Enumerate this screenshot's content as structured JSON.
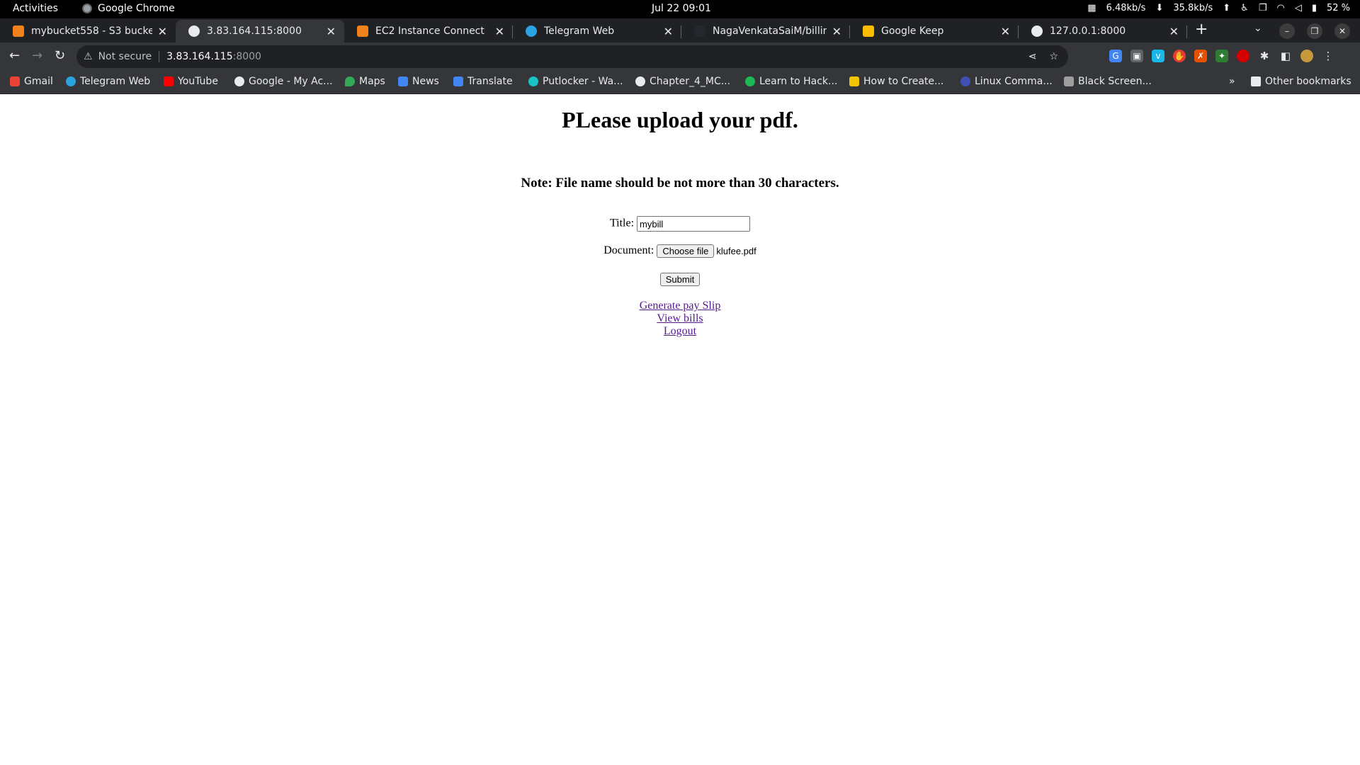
{
  "os": {
    "activities": "Activities",
    "app_name": "Google Chrome",
    "clock": "Jul 22  09:01",
    "net_down": "6.48kb/s",
    "net_up": "35.8kb/s",
    "battery": "52 %"
  },
  "tabs": [
    {
      "label": "mybucket558 - S3 bucket",
      "favicon_color": "#f0821e",
      "active": false
    },
    {
      "label": "3.83.164.115:8000",
      "favicon_color": "#e8eaed",
      "active": true
    },
    {
      "label": "EC2 Instance Connect",
      "favicon_color": "#f0821e",
      "active": false
    },
    {
      "label": "Telegram Web",
      "favicon_color": "#2aa3e0",
      "active": false
    },
    {
      "label": "NagaVenkataSaiM/billing",
      "favicon_color": "#24292f",
      "active": false
    },
    {
      "label": "Google Keep",
      "favicon_color": "#fbbc04",
      "active": false
    },
    {
      "label": "127.0.0.1:8000",
      "favicon_color": "#e8eaed",
      "active": false
    }
  ],
  "toolbar": {
    "security_label": "Not secure",
    "url_host": "3.83.164.115",
    "url_port": ":8000"
  },
  "bookmarks": [
    {
      "label": "Gmail",
      "color": "#ea4335"
    },
    {
      "label": "Telegram Web",
      "color": "#2aa3e0"
    },
    {
      "label": "YouTube",
      "color": "#ff0000"
    },
    {
      "label": "Google - My Ac...",
      "color": "#e8eaed"
    },
    {
      "label": "Maps",
      "color": "#34a853"
    },
    {
      "label": "News",
      "color": "#4285f4"
    },
    {
      "label": "Translate",
      "color": "#4285f4"
    },
    {
      "label": "Putlocker - Wa...",
      "color": "#19c3c3"
    },
    {
      "label": "Chapter_4_MC...",
      "color": "#e8eaed"
    },
    {
      "label": "Learn to Hack...",
      "color": "#1db954"
    },
    {
      "label": "How to Create...",
      "color": "#f5c400"
    },
    {
      "label": "Linux Comma...",
      "color": "#3f51b5"
    },
    {
      "label": "Black Screen...",
      "color": "#9e9e9e"
    }
  ],
  "other_bookmarks": "Other bookmarks",
  "page": {
    "heading": "PLease upload your pdf.",
    "note": "Note: File name should be not more than 30 characters.",
    "title_label": "Title:",
    "title_value": "mybill",
    "document_label": "Document:",
    "choose_file_label": "Choose file",
    "chosen_file": "klufee.pdf",
    "submit_label": "Submit",
    "links": [
      "Generate pay Slip",
      "View bills",
      "Logout"
    ]
  }
}
